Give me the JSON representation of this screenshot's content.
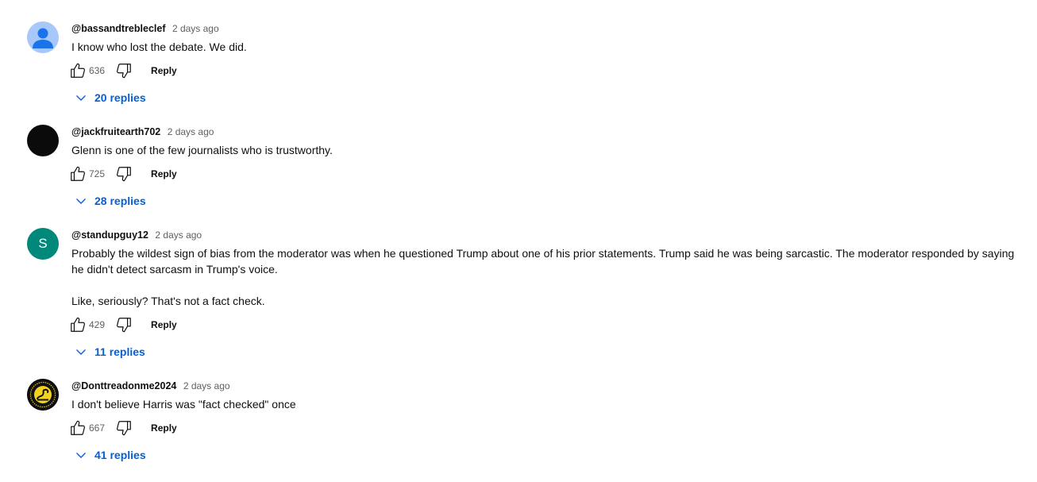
{
  "comments": [
    {
      "author": "@bassandtrebleclef",
      "time": "2 days ago",
      "avatar_type": "default-person-icon",
      "text": [
        "I know who lost the debate.  We did."
      ],
      "likes": "636",
      "reply_label": "Reply",
      "replies_label": "20 replies"
    },
    {
      "author": "@jackfruitearth702",
      "time": "2 days ago",
      "avatar_type": "dark",
      "text": [
        "Glenn is one of the few journalists who is trustworthy."
      ],
      "likes": "725",
      "reply_label": "Reply",
      "replies_label": "28 replies"
    },
    {
      "author": "@standupguy12",
      "time": "2 days ago",
      "avatar_type": "letter",
      "avatar_letter": "S",
      "avatar_color": "#00897b",
      "text": [
        "Probably the wildest sign of bias from the moderator was when he questioned Trump about one of his prior statements.  Trump said he was being sarcastic.  The moderator responded by saying he didn't detect sarcasm in Trump's voice.",
        "Like, seriously?  That's not a fact check."
      ],
      "likes": "429",
      "reply_label": "Reply",
      "replies_label": "11 replies"
    },
    {
      "author": "@Donttreadonme2024",
      "time": "2 days ago",
      "avatar_type": "gadsden-flag-icon",
      "text": [
        "I don't believe Harris  was \"fact checked\" once"
      ],
      "likes": "667",
      "reply_label": "Reply",
      "replies_label": "41 replies"
    }
  ],
  "colors": {
    "link_blue": "#065fd4",
    "secondary_text": "#606060",
    "primary_text": "#0f0f0f"
  }
}
